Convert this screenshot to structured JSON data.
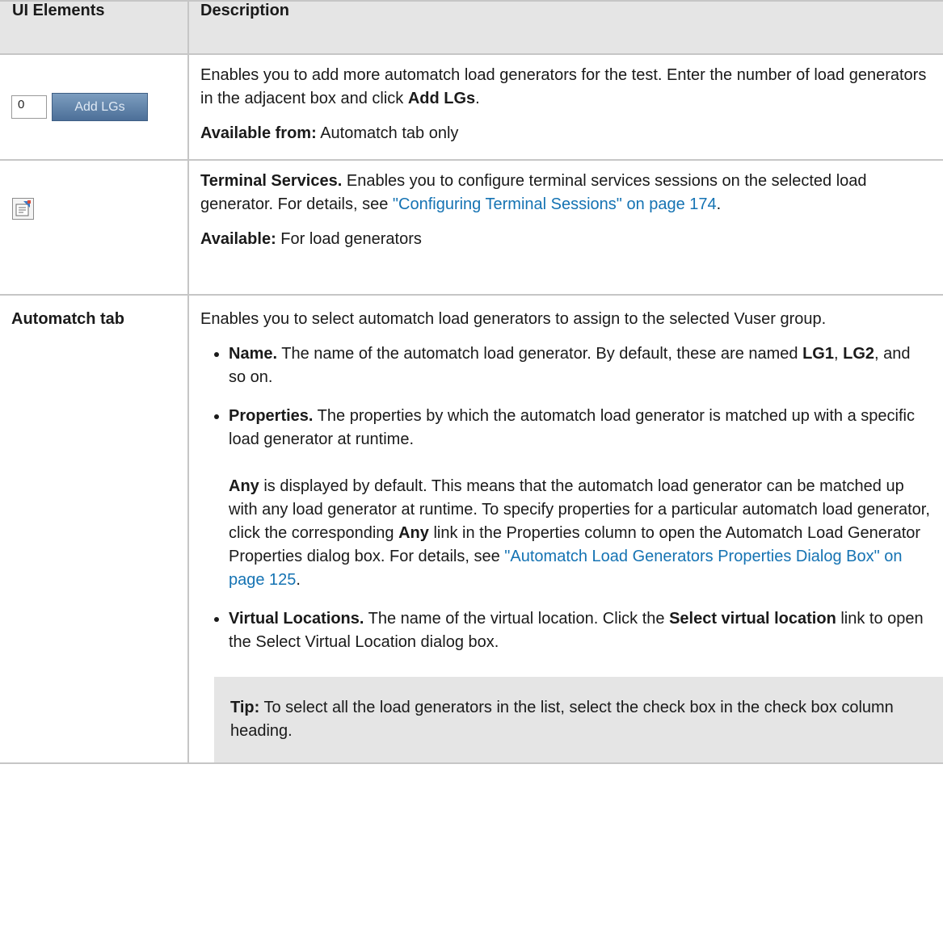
{
  "header": {
    "col1": "UI Elements",
    "col2": "Description"
  },
  "rows": {
    "add_lgs": {
      "input_value": "0",
      "button_label": "Add LGs",
      "desc1": "Enables you to add more automatch load generators for the test. Enter the number of load generators in the adjacent box and click ",
      "desc1_bold": "Add LGs",
      "desc1_end": ".",
      "avail_label": "Available from:",
      "avail_text": " Automatch tab only"
    },
    "terminal": {
      "icon": "terminal-services-icon",
      "title": "Terminal Services.",
      "desc": " Enables you to configure terminal services sessions on the selected load generator. For details, see ",
      "link": "\"Configuring Terminal Sessions\" on page 174",
      "desc_end": ".",
      "avail_label": "Available:",
      "avail_text": " For load generators"
    },
    "automatch": {
      "label": "Automatch tab",
      "intro": "Enables you to select automatch load generators to assign to the selected Vuser group.",
      "name_label": "Name.",
      "name_text1": " The name of the automatch load generator. By default, these are named ",
      "name_lg1": "LG1",
      "name_sep": ", ",
      "name_lg2": "LG2",
      "name_text2": ", and so on.",
      "props_label": "Properties.",
      "props_text": " The properties by which the automatch load generator is matched up with a specific load generator at runtime.",
      "any_label": "Any",
      "any_text1": " is displayed by default. This means that the automatch load generator can be matched up with any load generator at runtime. To specify properties for a particular automatch load generator, click the corresponding ",
      "any_label2": "Any",
      "any_text2": " link in the Properties column to open the Automatch Load Generator Properties dialog box. For details, see ",
      "any_link": "\"Automatch Load Generators Properties Dialog Box\" on page 125",
      "any_end": ".",
      "vl_label": "Virtual Locations.",
      "vl_text1": " The name of the virtual location. Click the ",
      "vl_bold": "Select virtual location",
      "vl_text2": " link to open the Select Virtual Location dialog box.",
      "tip_label": "Tip:",
      "tip_text": " To select all the load generators in the list, select the check box in the check box column heading."
    }
  },
  "colors": {
    "link": "#1573b3",
    "header_bg": "#e5e5e5",
    "border": "#c6c6c6",
    "button": "#5a7ea6"
  }
}
